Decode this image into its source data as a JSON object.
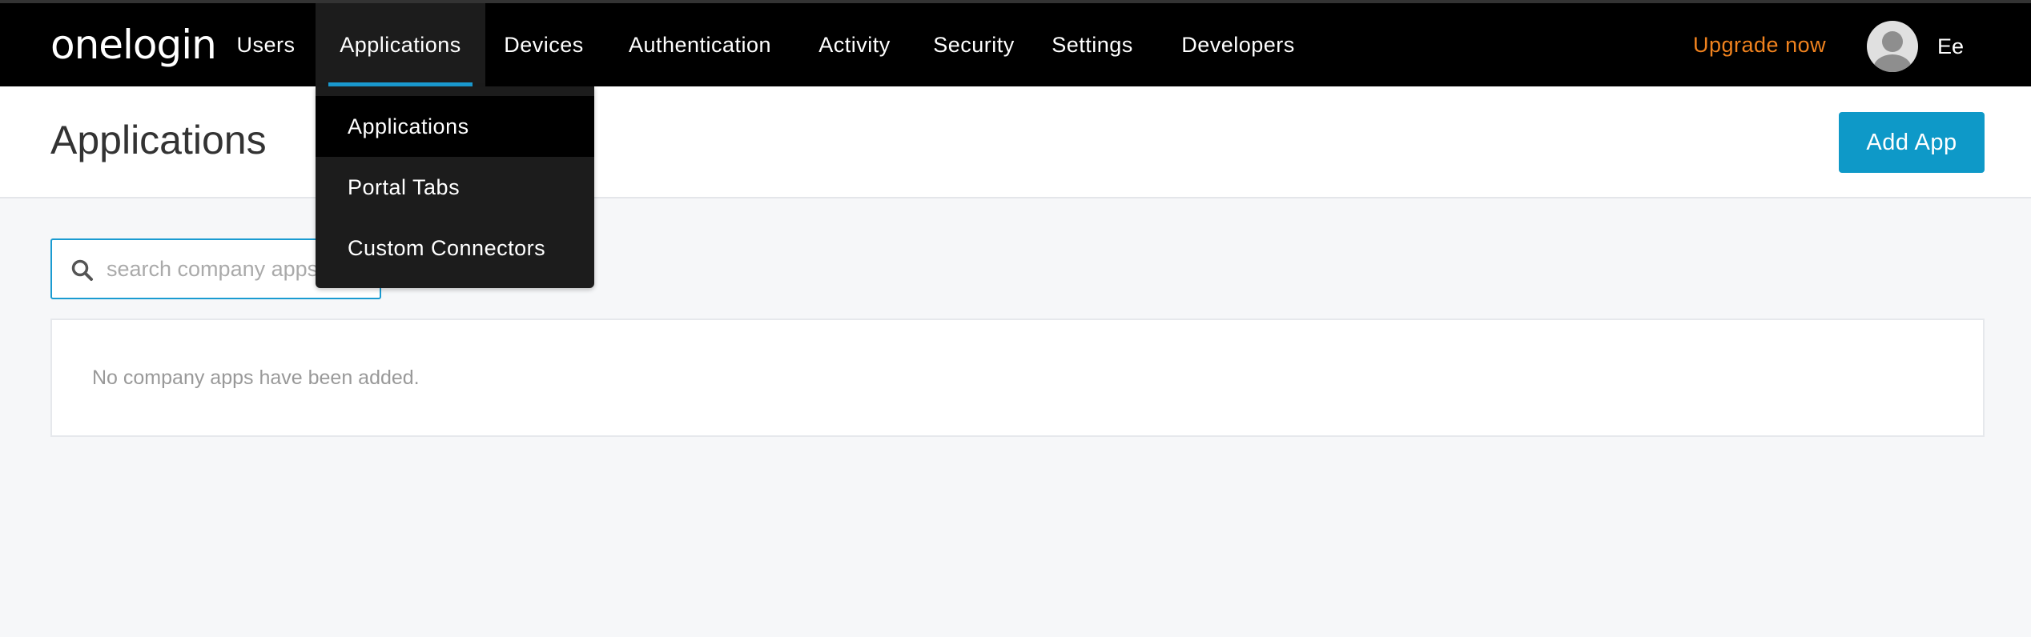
{
  "topbar": {
    "logo": "onelogin",
    "nav": [
      {
        "label": "Users"
      },
      {
        "label": "Applications",
        "active": true
      },
      {
        "label": "Devices"
      },
      {
        "label": "Authentication"
      },
      {
        "label": "Activity"
      },
      {
        "label": "Security"
      },
      {
        "label": "Settings"
      },
      {
        "label": "Developers"
      }
    ],
    "upgrade_label": "Upgrade now",
    "user_initials": "Ee"
  },
  "dropdown": {
    "items": [
      {
        "label": "Applications",
        "selected": true
      },
      {
        "label": "Portal Tabs"
      },
      {
        "label": "Custom Connectors"
      }
    ]
  },
  "header": {
    "title": "Applications",
    "add_button_label": "Add App"
  },
  "search": {
    "placeholder": "search company apps",
    "value": ""
  },
  "empty_state": {
    "message": "No company apps have been added."
  },
  "colors": {
    "accent": "#1a9bd1",
    "button": "#0e99c8",
    "upgrade": "#f0821e",
    "topbar": "#000000"
  }
}
